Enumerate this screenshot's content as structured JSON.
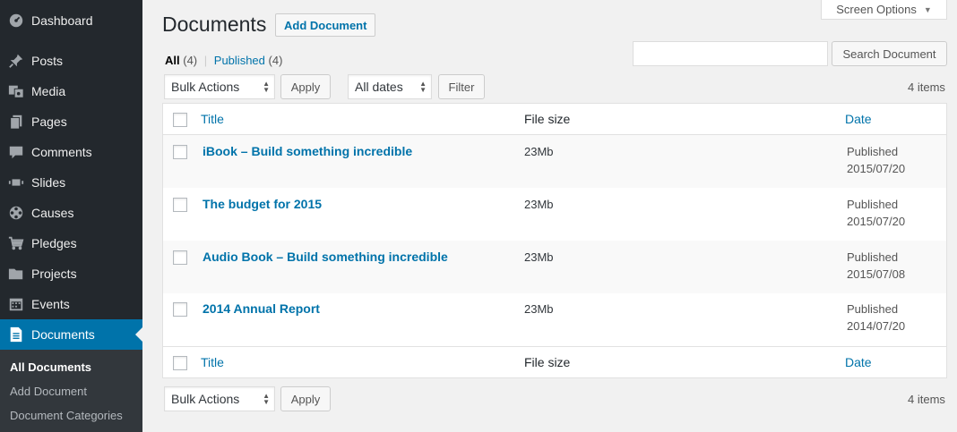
{
  "sidebar": {
    "items": [
      {
        "label": "Dashboard",
        "icon": "dashboard-icon"
      },
      {
        "label": "Posts",
        "icon": "pin-icon"
      },
      {
        "label": "Media",
        "icon": "media-icon"
      },
      {
        "label": "Pages",
        "icon": "pages-icon"
      },
      {
        "label": "Comments",
        "icon": "comment-icon"
      },
      {
        "label": "Slides",
        "icon": "slides-icon"
      },
      {
        "label": "Causes",
        "icon": "causes-icon"
      },
      {
        "label": "Pledges",
        "icon": "cart-icon"
      },
      {
        "label": "Projects",
        "icon": "folder-icon"
      },
      {
        "label": "Events",
        "icon": "calendar-icon"
      },
      {
        "label": "Documents",
        "icon": "document-icon",
        "current": true
      }
    ],
    "submenu": [
      "All Documents",
      "Add Document",
      "Document Categories"
    ]
  },
  "screen_options": "Screen Options",
  "header": {
    "title": "Documents",
    "add_new": "Add Document"
  },
  "views": {
    "all_label": "All",
    "all_count": "(4)",
    "separator": "|",
    "published_label": "Published",
    "published_count": "(4)"
  },
  "search": {
    "button": "Search Document",
    "value": ""
  },
  "tablenav": {
    "bulk_actions": "Bulk Actions",
    "apply": "Apply",
    "dates": "All dates",
    "filter": "Filter",
    "items": "4 items"
  },
  "table": {
    "columns": {
      "title": "Title",
      "size": "File size",
      "date": "Date"
    },
    "rows": [
      {
        "title": "iBook – Build something incredible",
        "size": "23Mb",
        "status": "Published",
        "date": "2015/07/20"
      },
      {
        "title": "The budget for 2015",
        "size": "23Mb",
        "status": "Published",
        "date": "2015/07/20"
      },
      {
        "title": "Audio Book – Build something incredible",
        "size": "23Mb",
        "status": "Published",
        "date": "2015/07/08"
      },
      {
        "title": "2014 Annual Report",
        "size": "23Mb",
        "status": "Published",
        "date": "2014/07/20"
      }
    ]
  },
  "colors": {
    "sidebar": "#23282d",
    "accent": "#0073aa",
    "background": "#f1f1f1"
  }
}
